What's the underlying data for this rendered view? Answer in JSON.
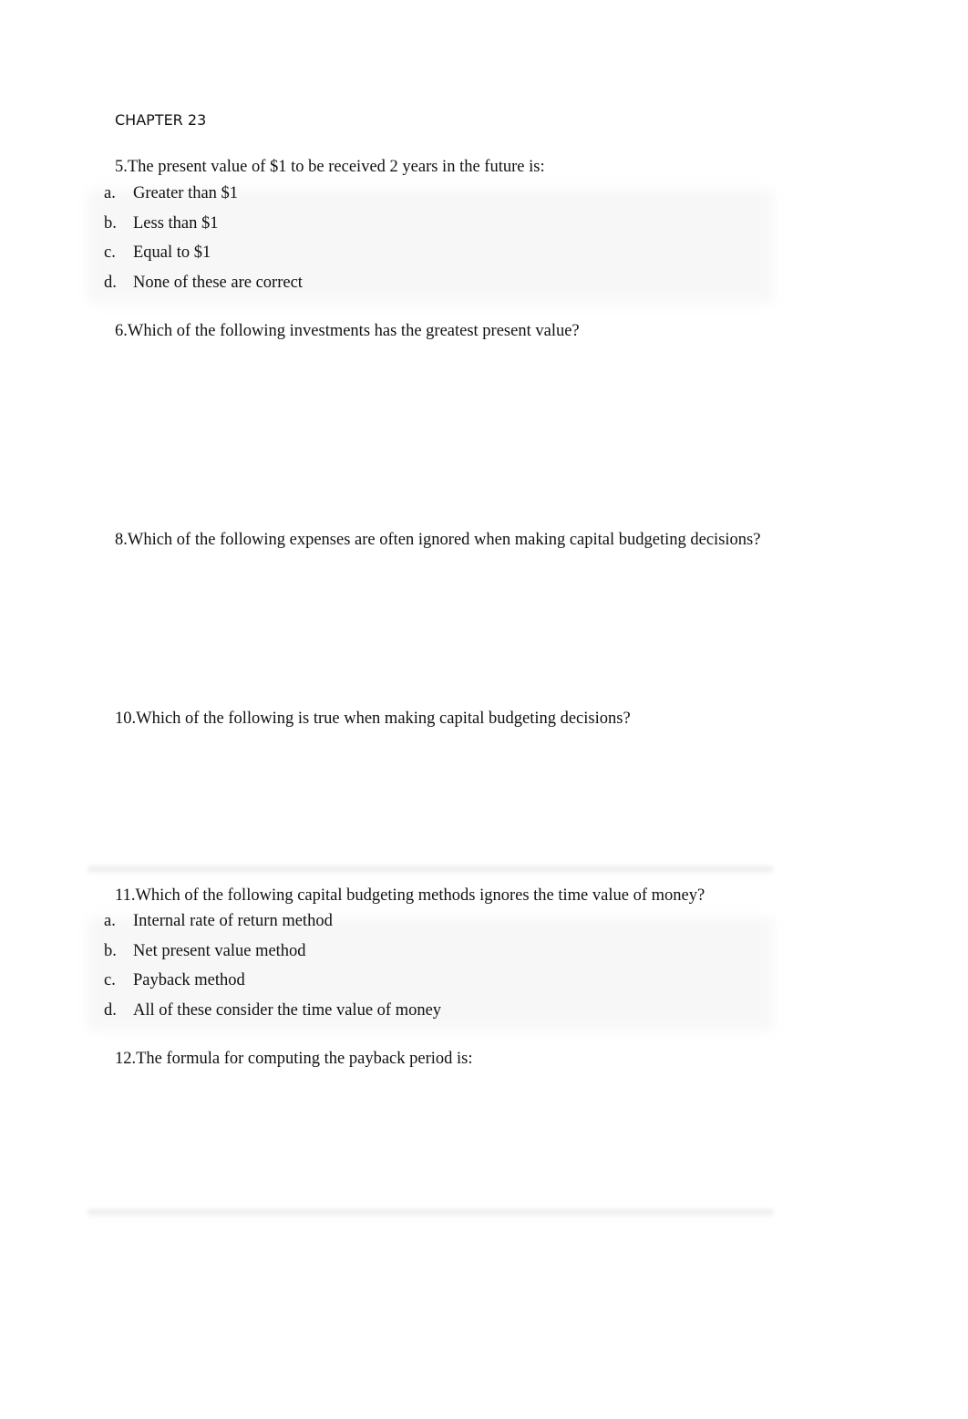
{
  "document": {
    "heading": "CHAPTER 23",
    "questions": [
      {
        "text": "5.The present value of $1 to be received 2 years in the future is:",
        "options": [
          {
            "letter": "a.",
            "text": "Greater than $1"
          },
          {
            "letter": "b.",
            "text": "Less than $1"
          },
          {
            "letter": "c.",
            "text": "Equal to $1"
          },
          {
            "letter": "d.",
            "text": "None of these are correct"
          }
        ]
      },
      {
        "text": "6.Which of the following investments has the greatest present value?",
        "options": []
      },
      {
        "text": "8.Which of the following expenses are often ignored when making capital budgeting decisions?",
        "options": []
      },
      {
        "text": "10.Which of the following is true when making capital budgeting decisions?",
        "options": []
      },
      {
        "text": "11.Which of the following capital budgeting methods ignores the time value of money?",
        "options": [
          {
            "letter": "a.",
            "text": "Internal rate of return method"
          },
          {
            "letter": "b.",
            "text": "Net present value method"
          },
          {
            "letter": "c.",
            "text": "Payback method"
          },
          {
            "letter": "d.",
            "text": "All of these consider the time value of money"
          }
        ]
      },
      {
        "text": "12.The formula for computing the payback period is:",
        "options": []
      }
    ]
  }
}
